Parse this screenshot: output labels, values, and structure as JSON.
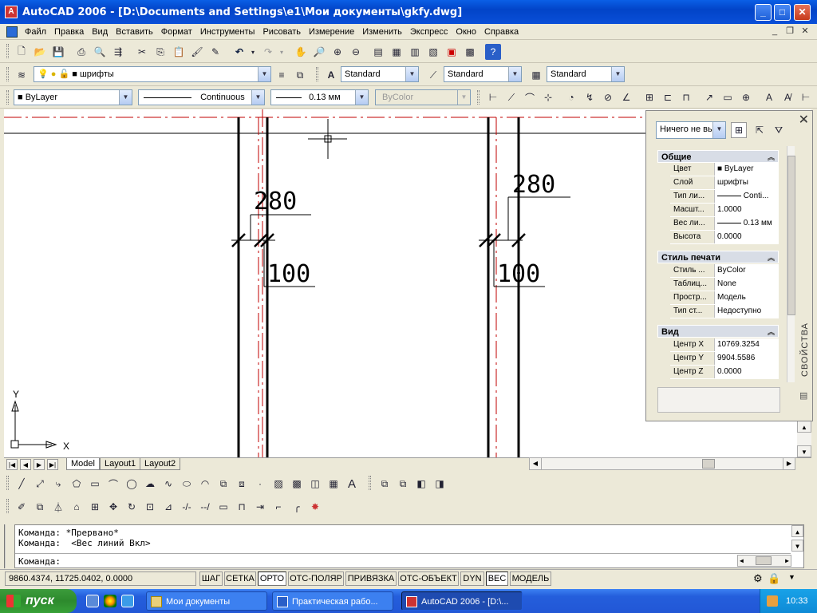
{
  "window": {
    "title": "AutoCAD 2006 - [D:\\Documents and Settings\\e1\\Мои документы\\gkfy.dwg]",
    "app_icon": "autocad-icon"
  },
  "menu": {
    "items": [
      "Файл",
      "Правка",
      "Вид",
      "Вставить",
      "Формат",
      "Инструменты",
      "Рисовать",
      "Измерение",
      "Изменить",
      "Экспресс",
      "Окно",
      "Справка"
    ]
  },
  "toolbar2": {
    "layer_name": "шрифты",
    "text_style": "Standard",
    "dim_style": "Standard",
    "table_style": "Standard"
  },
  "toolbar3": {
    "color": "ByLayer",
    "linetype": "Continuous",
    "lineweight": "0.13 мм",
    "plotstyle": "ByColor"
  },
  "drawing": {
    "dim_labels": [
      "280",
      "100",
      "280",
      "100"
    ],
    "ucs_x": "X",
    "ucs_y": "Y",
    "accent_red": "#c00000"
  },
  "properties": {
    "selection": "Ничего не вы",
    "side_label": "СВОЙСТВА",
    "general": {
      "title": "Общие",
      "rows": [
        {
          "k": "Цвет",
          "v": "ByLayer"
        },
        {
          "k": "Слой",
          "v": "шрифты"
        },
        {
          "k": "Тип ли...",
          "v": "Conti..."
        },
        {
          "k": "Масшт...",
          "v": "1.0000"
        },
        {
          "k": "Вес ли...",
          "v": "0.13 мм"
        },
        {
          "k": "Высота",
          "v": "0.0000"
        }
      ]
    },
    "plot": {
      "title": "Стиль печати",
      "rows": [
        {
          "k": "Стиль ...",
          "v": "ByColor"
        },
        {
          "k": "Таблиц...",
          "v": "None"
        },
        {
          "k": "Простр...",
          "v": "Модель"
        },
        {
          "k": "Тип ст...",
          "v": "Недоступно"
        }
      ]
    },
    "view": {
      "title": "Вид",
      "rows": [
        {
          "k": "Центр X",
          "v": "10769.3254"
        },
        {
          "k": "Центр Y",
          "v": "9904.5586"
        },
        {
          "k": "Центр Z",
          "v": "0.0000"
        }
      ]
    }
  },
  "layout_tabs": [
    "Model",
    "Layout1",
    "Layout2"
  ],
  "command": {
    "line1": "Команда: *Прервано*",
    "line2": "Команда:  <Вес линий Вкл>",
    "prompt": "Команда:"
  },
  "status": {
    "coords": "9860.4374, 11725.0402, 0.0000",
    "buttons": [
      "ШАГ",
      "СЕТКА",
      "ОРТО",
      "ОТС-ПОЛЯР",
      "ПРИВЯЗКА",
      "ОТС-ОБЪЕКТ",
      "DYN",
      "ВЕС",
      "МОДЕЛЬ"
    ],
    "active": [
      "ОРТО",
      "ВЕС"
    ]
  },
  "taskbar": {
    "start": "пуск",
    "tasks": [
      "Мои документы",
      "Практическая рабо...",
      "AutoCAD 2006 - [D:\\..."
    ],
    "clock": "10:33"
  }
}
